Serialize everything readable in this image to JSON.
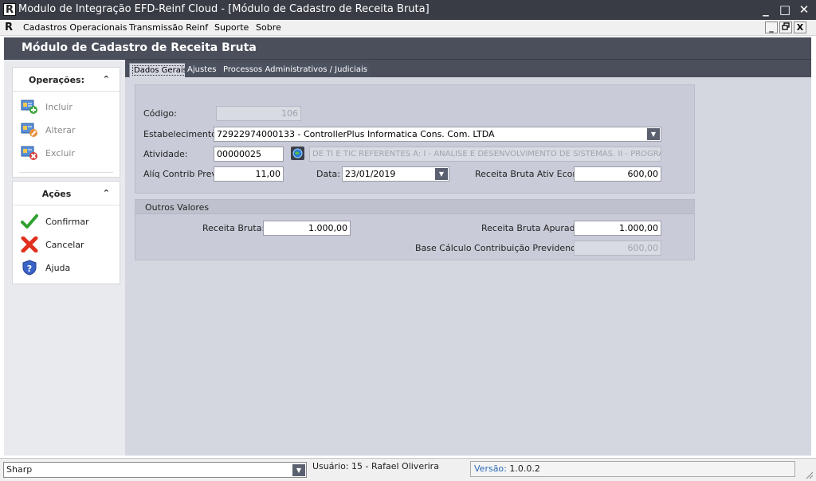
{
  "window": {
    "title": "Modulo de Integração EFD-Reinf Cloud - [Módulo de Cadastro de Receita Bruta]",
    "minimize": "_",
    "maximize": "□",
    "close": "✕"
  },
  "menubar": {
    "items": [
      "Cadastros Operacionais",
      "Transmissão Reinf",
      "Suporte",
      "Sobre"
    ],
    "mdi_minimize": "_",
    "mdi_restore": "🗗",
    "mdi_close": "X"
  },
  "module": {
    "title": "Módulo de Cadastro de Receita Bruta"
  },
  "operacoes": {
    "title": "Operações:",
    "items": [
      {
        "label": "Incluir",
        "icon": "add-record-icon"
      },
      {
        "label": "Alterar",
        "icon": "edit-record-icon"
      },
      {
        "label": "Excluir",
        "icon": "delete-record-icon"
      }
    ]
  },
  "acoes": {
    "title": "Ações",
    "items": [
      {
        "label": "Confirmar",
        "icon": "check-icon"
      },
      {
        "label": "Cancelar",
        "icon": "cross-icon"
      },
      {
        "label": "Ajuda",
        "icon": "help-shield-icon"
      }
    ]
  },
  "tabs": [
    "Dados Gerais",
    "Ajustes",
    "Processos Administrativos / Judiciais"
  ],
  "form": {
    "codigo_label": "Código:",
    "codigo_value": "106",
    "estab_label": "Estabelecimento:",
    "estab_value": "72922974000133 - ControllerPlus Informatica Cons. Com. LTDA",
    "atividade_label": "Atividade:",
    "atividade_code": "00000025",
    "atividade_desc": "DE TI E TIC REFERENTES A: I - ANALISE E DESENVOLVIMENTO DE SISTEMAS. II - PROGRAMAÇ",
    "aliq_label": "Alíq Contrib Prev:",
    "aliq_value": "11,00",
    "data_label": "Data:",
    "data_value": "23/01/2019",
    "rbae_label": "Receita Bruta Ativ Econ:",
    "rbae_value": "600,00"
  },
  "outros": {
    "title": "Outros Valores",
    "rb_label": "Receita Bruta:",
    "rb_value": "1.000,00",
    "rba_label": "Receita Bruta Apurada:",
    "rba_value": "1.000,00",
    "base_label": "Base Cálculo Contribuição Previdenciária:",
    "base_value": "600,00"
  },
  "status": {
    "combo_value": "Sharp",
    "user": "Usuário: 15 - Rafael Oliverira",
    "version_label": "Versão:",
    "version_value": "1.0.0.2"
  },
  "colors": {
    "titlebar": "#393c44",
    "header": "#4a4f5b",
    "form_bg": "#d4d6e0"
  }
}
